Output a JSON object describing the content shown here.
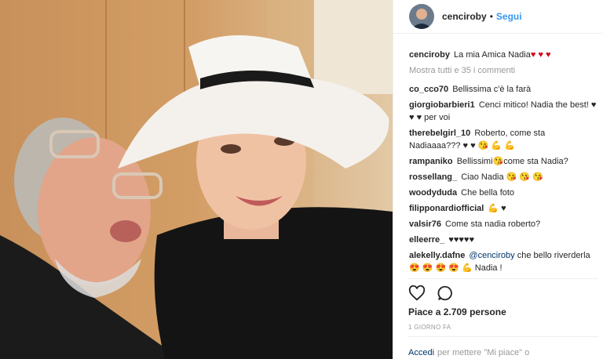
{
  "header": {
    "username": "cenciroby",
    "separator": "•",
    "follow_label": "Segui"
  },
  "caption": {
    "username": "cenciroby",
    "text": "La mia Amica Nadia",
    "emojis": "♥ ♥ ♥"
  },
  "view_all": "Mostra tutti e 35 i commenti",
  "comments": [
    {
      "user": "co_cco70",
      "text": "Bellissima c'è la farà"
    },
    {
      "user": "giorgiobarbieri1",
      "text": "Cenci mitico! Nadia the best! ♥ ♥ ♥ per voi"
    },
    {
      "user": "therebelgirl_10",
      "text": "Roberto, come sta Nadiaaaa??? ♥ ♥ 😘 💪 💪"
    },
    {
      "user": "rampaniko",
      "text": "Bellissimi😘come sta Nadia?"
    },
    {
      "user": "rossellang_",
      "text": "Ciao Nadia 😘 😘 😘"
    },
    {
      "user": "woodyduda",
      "text": "Che bella foto"
    },
    {
      "user": "filipponardiofficial",
      "text": "💪 ♥"
    },
    {
      "user": "valsir76",
      "text": "Come sta nadia roberto?"
    },
    {
      "user": "elleerre_",
      "text": "♥♥♥♥♥"
    },
    {
      "user": "alekelly.dafne",
      "mention": "@cenciroby",
      "text": "che bello riverderla 😍 😍 😍 😍 💪 Nadia !"
    }
  ],
  "actions": {
    "like_icon": "heart-outline-icon",
    "comment_icon": "speech-bubble-icon"
  },
  "likes": "Piace a 2.709 persone",
  "date": "1 GIORNO FA",
  "login": {
    "link": "Accedi",
    "text": "per mettere \"Mi piace\" o"
  },
  "colors": {
    "link_blue": "#3897f0",
    "text": "#262626",
    "muted": "#999999",
    "heart": "#d0021b"
  }
}
